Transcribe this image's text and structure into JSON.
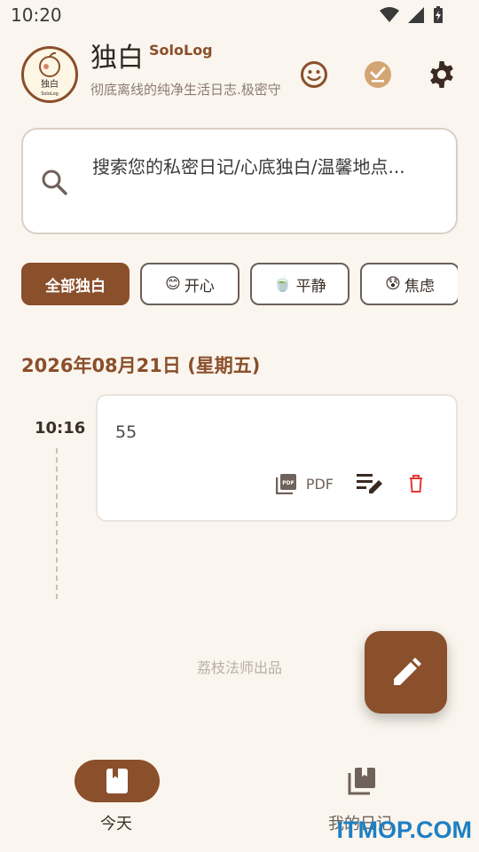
{
  "status_bar": {
    "time": "10:20"
  },
  "header": {
    "title": "独白",
    "subtitle": "SoloLog",
    "tagline": "彻底离线的纯净生活日志.极密守",
    "logo_text": "独白",
    "logo_subtext": "SoloLog",
    "buttons": [
      "smile-icon",
      "check-icon",
      "gear-icon"
    ]
  },
  "search": {
    "placeholder": "搜索您的私密日记/心底独白/温馨地点..."
  },
  "filters": [
    {
      "emoji": "",
      "label": "全部独白",
      "active": true
    },
    {
      "emoji": "😊",
      "label": "开心",
      "active": false
    },
    {
      "emoji": "🍵",
      "label": "平静",
      "active": false
    },
    {
      "emoji": "😰",
      "label": "焦虑",
      "active": false
    }
  ],
  "date_heading": "2026年08月21日 (星期五)",
  "entries": [
    {
      "time": "10:16",
      "text": "55",
      "pdf_label": "PDF"
    }
  ],
  "footer_credit": "荔枝法师出品",
  "bottom_nav": [
    {
      "label": "今天",
      "icon": "book-icon",
      "active": true
    },
    {
      "label": "我的日记",
      "icon": "library-icon",
      "active": false
    }
  ],
  "watermark": "ITMOP.COM",
  "colors": {
    "accent": "#8a4f2b",
    "background": "#faf5ee",
    "delete": "#e53935"
  }
}
